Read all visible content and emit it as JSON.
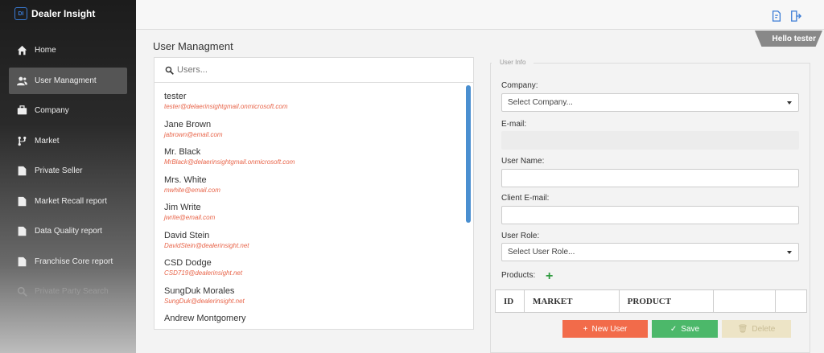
{
  "app": {
    "title": "Dealer Insight",
    "logo_text": "DI"
  },
  "sidebar": {
    "items": [
      {
        "label": "Home",
        "icon": "home-icon"
      },
      {
        "label": "User Managment",
        "icon": "users-icon"
      },
      {
        "label": "Company",
        "icon": "briefcase-icon"
      },
      {
        "label": "Market",
        "icon": "branch-icon"
      },
      {
        "label": "Private Seller",
        "icon": "document-icon"
      },
      {
        "label": "Market Recall report",
        "icon": "report-icon"
      },
      {
        "label": "Data Quality report",
        "icon": "report-icon"
      },
      {
        "label": "Franchise Core report",
        "icon": "report-icon"
      },
      {
        "label": "Private Party Search",
        "icon": "search-icon"
      }
    ],
    "active_index": 1
  },
  "header": {
    "greeting": "Hello tester",
    "icons": [
      "edit-icon",
      "logout-icon"
    ]
  },
  "page": {
    "title": "User Managment"
  },
  "users": {
    "search_placeholder": "Users...",
    "list": [
      {
        "name": "tester",
        "email": "tester@delaerinsightgmail.onmicrosoft.com"
      },
      {
        "name": "Jane Brown",
        "email": "jabrown@email.com"
      },
      {
        "name": "Mr. Black",
        "email": "MrBlack@delaerinsightgmail.onmicrosoft.com"
      },
      {
        "name": "Mrs. White",
        "email": "mwhite@email.com"
      },
      {
        "name": "Jim Write",
        "email": "jwrite@email.com"
      },
      {
        "name": "David Stein",
        "email": "DavidStein@dealerinsight.net"
      },
      {
        "name": "CSD Dodge",
        "email": "CSD719@dealerinsight.net"
      },
      {
        "name": "SungDuk Morales",
        "email": "SungDuk@dealerinsight.net"
      },
      {
        "name": "Andrew Montgomery",
        "email": ""
      }
    ]
  },
  "user_info": {
    "legend": "User Info",
    "company_label": "Company:",
    "company_value": "Select Company...",
    "email_label": "E-mail:",
    "email_value": "",
    "username_label": "User Name:",
    "username_value": "",
    "client_email_label": "Client E-mail:",
    "client_email_value": "",
    "role_label": "User Role:",
    "role_value": "Select User Role...",
    "products_label": "Products:",
    "table_headers": [
      "ID",
      "MARKET",
      "PRODUCT",
      "",
      ""
    ]
  },
  "buttons": {
    "new_user": "New User",
    "save": "Save",
    "delete": "Delete"
  },
  "colors": {
    "accent": "#3a7bd5",
    "email": "#e8654a",
    "new": "#f26b4a",
    "save": "#4cb86a",
    "delete": "#ede4c6"
  }
}
